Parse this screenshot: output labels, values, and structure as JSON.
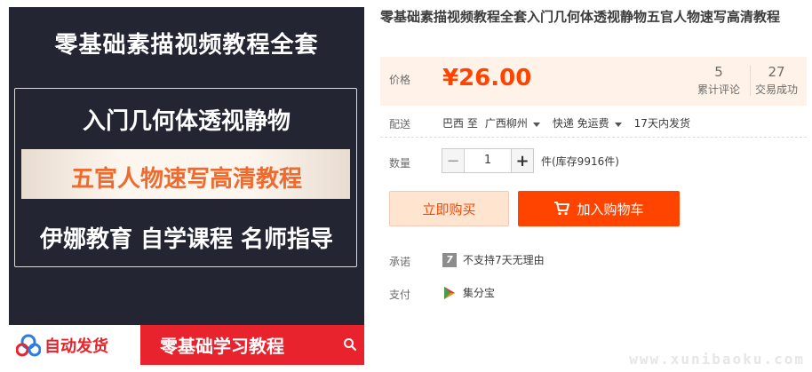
{
  "image": {
    "title": "零基础素描视频教程全套",
    "line1": "入门几何体透视静物",
    "line2": "五官人物速写高清教程",
    "line3": "伊娜教育 自学课程 名师指导",
    "auto_ship": "自动发货",
    "learn_banner": "零基础学习教程"
  },
  "product": {
    "title": "零基础素描视频教程全套入门几何体透视静物五官人物速写高清教程",
    "price_label": "价格",
    "currency": "¥",
    "price": "26.00",
    "reviews_count": "5",
    "reviews_label": "累计评论",
    "sales_count": "27",
    "sales_label": "交易成功"
  },
  "shipping": {
    "label": "配送",
    "from": "巴西 至",
    "to": "广西柳州",
    "method": "快递 免运费",
    "dispatch": "17天内发货"
  },
  "quantity": {
    "label": "数量",
    "value": "1",
    "stock": "件(库存9916件)"
  },
  "actions": {
    "buy_now": "立即购买",
    "add_to_cart": "加入购物车"
  },
  "service": {
    "label": "承诺",
    "badge": "7",
    "text": "不支持7天无理由"
  },
  "payment": {
    "label": "支付",
    "method": "集分宝"
  },
  "watermark": "www.xunibaoku.com",
  "colors": {
    "accent": "#ff4400",
    "price_bg": "#fff2e8",
    "image_bg": "#232532"
  }
}
